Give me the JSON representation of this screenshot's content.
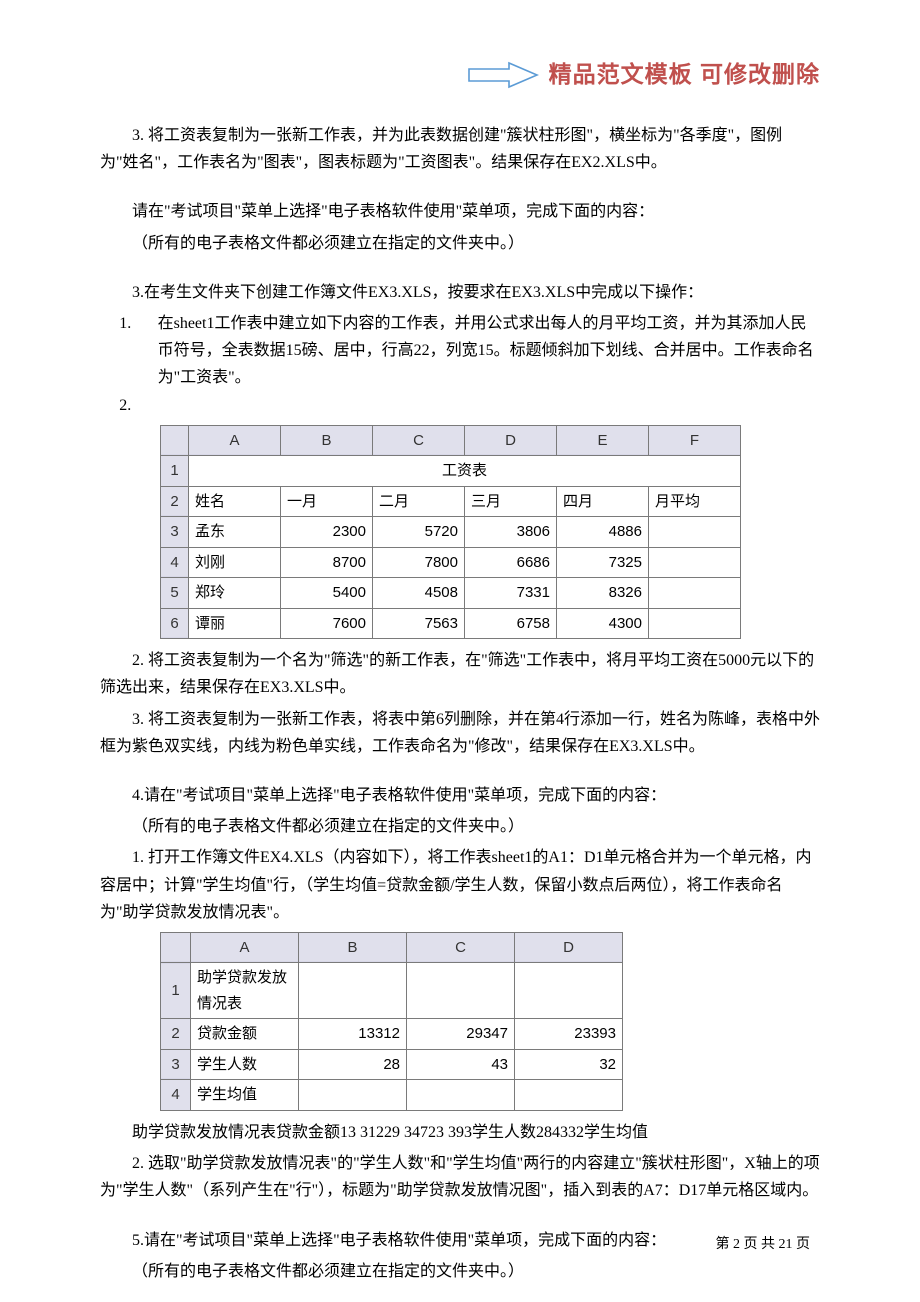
{
  "header": {
    "title": "精品范文模板  可修改删除"
  },
  "body": {
    "p1": "3. 将工资表复制为一张新工作表，并为此表数据创建\"簇状柱形图\"，横坐标为\"各季度\"，图例为\"姓名\"，工作表名为\"图表\"，图表标题为\"工资图表\"。结果保存在EX2.XLS中。",
    "p2": "请在\"考试项目\"菜单上选择\"电子表格软件使用\"菜单项，完成下面的内容：",
    "p3": "（所有的电子表格文件都必须建立在指定的文件夹中。）",
    "p4": "3.在考生文件夹下创建工作簿文件EX3.XLS，按要求在EX3.XLS中完成以下操作：",
    "sub1_num": "1.",
    "sub1_txt": "在sheet1工作表中建立如下内容的工作表，并用公式求出每人的月平均工资，并为其添加人民币符号，全表数据15磅、居中，行高22，列宽15。标题倾斜加下划线、合并居中。工作表命名为\"工资表\"。",
    "sub2_num": "2.",
    "p5": "2. 将工资表复制为一个名为\"筛选\"的新工作表，在\"筛选\"工作表中，将月平均工资在5000元以下的筛选出来，结果保存在EX3.XLS中。",
    "p6": "3. 将工资表复制为一张新工作表，将表中第6列删除，并在第4行添加一行，姓名为陈峰，表格中外框为紫色双实线，内线为粉色单实线，工作表命名为\"修改\"，结果保存在EX3.XLS中。",
    "p7": "4.请在\"考试项目\"菜单上选择\"电子表格软件使用\"菜单项，完成下面的内容：",
    "p8": "（所有的电子表格文件都必须建立在指定的文件夹中。）",
    "p9": "1. 打开工作簿文件EX4.XLS（内容如下），将工作表sheet1的A1：D1单元格合并为一个单元格，内容居中；计算\"学生均值\"行，（学生均值=贷款金额/学生人数，保留小数点后两位），将工作表命名为\"助学贷款发放情况表\"。",
    "p10": "助学贷款发放情况表贷款金额13 31229 34723 393学生人数284332学生均值",
    "p11": "2. 选取\"助学贷款发放情况表\"的\"学生人数\"和\"学生均值\"两行的内容建立\"簇状柱形图\"，X轴上的项为\"学生人数\"（系列产生在\"行\"），标题为\"助学贷款发放情况图\"，插入到表的A7：D17单元格区域内。",
    "p12": "5.请在\"考试项目\"菜单上选择\"电子表格软件使用\"菜单项，完成下面的内容：",
    "p13": "（所有的电子表格文件都必须建立在指定的文件夹中。）"
  },
  "table1": {
    "cols": [
      "A",
      "B",
      "C",
      "D",
      "E",
      "F"
    ],
    "title": "工资表",
    "headers": [
      "姓名",
      "一月",
      "二月",
      "三月",
      "四月",
      "月平均"
    ],
    "rows": [
      {
        "n": "3",
        "name": "孟东",
        "v": [
          "2300",
          "5720",
          "3806",
          "4886",
          ""
        ]
      },
      {
        "n": "4",
        "name": "刘刚",
        "v": [
          "8700",
          "7800",
          "6686",
          "7325",
          ""
        ]
      },
      {
        "n": "5",
        "name": "郑玲",
        "v": [
          "5400",
          "4508",
          "7331",
          "8326",
          ""
        ]
      },
      {
        "n": "6",
        "name": "谭丽",
        "v": [
          "7600",
          "7563",
          "6758",
          "4300",
          ""
        ]
      }
    ],
    "rownums_top": [
      "1",
      "2"
    ]
  },
  "table2": {
    "cols": [
      "A",
      "B",
      "C",
      "D"
    ],
    "rows": [
      {
        "n": "1",
        "cells": [
          "助学贷款发放情况表",
          "",
          "",
          ""
        ]
      },
      {
        "n": "2",
        "cells": [
          "贷款金额",
          "13312",
          "29347",
          "23393"
        ]
      },
      {
        "n": "3",
        "cells": [
          "学生人数",
          "28",
          "43",
          "32"
        ]
      },
      {
        "n": "4",
        "cells": [
          "学生均值",
          "",
          "",
          ""
        ]
      }
    ]
  },
  "footer": {
    "text": "第 2 页 共 21 页"
  }
}
